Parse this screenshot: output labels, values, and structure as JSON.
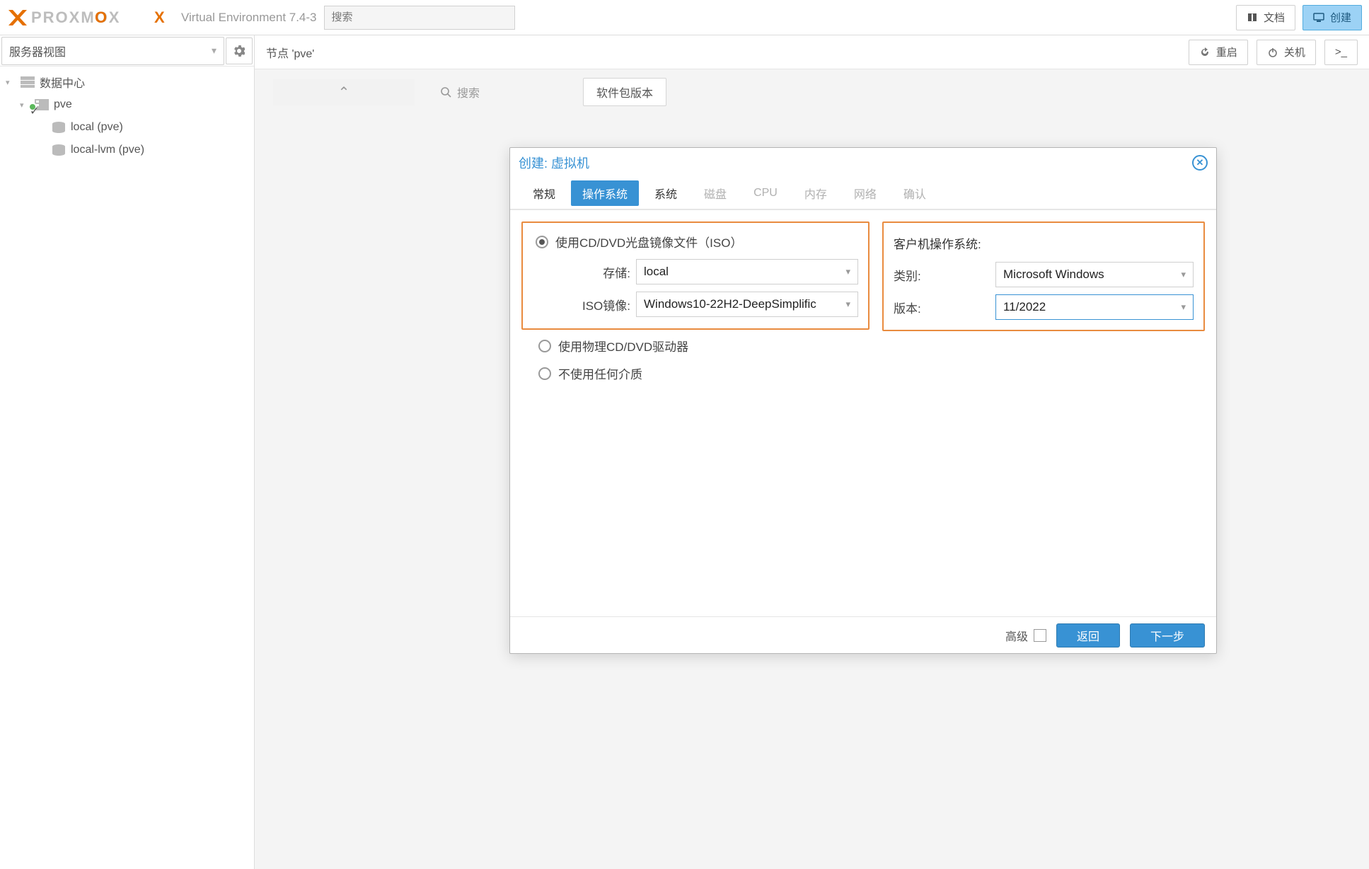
{
  "header": {
    "brand": "PROXMOX",
    "version_label": "Virtual Environment 7.4-3",
    "search_placeholder": "搜索",
    "docs_button": "文档",
    "create_button": "创建"
  },
  "sidebar": {
    "view_mode": "服务器视图",
    "tree": {
      "datacenter": "数据中心",
      "node": "pve",
      "storage1": "local (pve)",
      "storage2": "local-lvm (pve)"
    }
  },
  "content": {
    "node_label": "节点 'pve'",
    "restart_button": "重启",
    "shutdown_button": "关机",
    "shell_button": ">_",
    "search_label": "搜索",
    "pkg_button": "软件包版本"
  },
  "dialog": {
    "title": "创建: 虚拟机",
    "tabs": {
      "general": "常规",
      "os": "操作系统",
      "system": "系统",
      "disks": "磁盘",
      "cpu": "CPU",
      "memory": "内存",
      "network": "网络",
      "confirm": "确认"
    },
    "os_panel": {
      "radio_iso": "使用CD/DVD光盘镜像文件（ISO）",
      "storage_label": "存储:",
      "storage_value": "local",
      "iso_label": "ISO镜像:",
      "iso_value": "Windows10-22H2-DeepSimplific",
      "radio_physical": "使用物理CD/DVD驱动器",
      "radio_none": "不使用任何介质"
    },
    "guest_panel": {
      "title": "客户机操作系统:",
      "type_label": "类别:",
      "type_value": "Microsoft Windows",
      "version_label": "版本:",
      "version_value": "11/2022"
    },
    "footer": {
      "advanced": "高级",
      "back": "返回",
      "next": "下一步"
    }
  }
}
